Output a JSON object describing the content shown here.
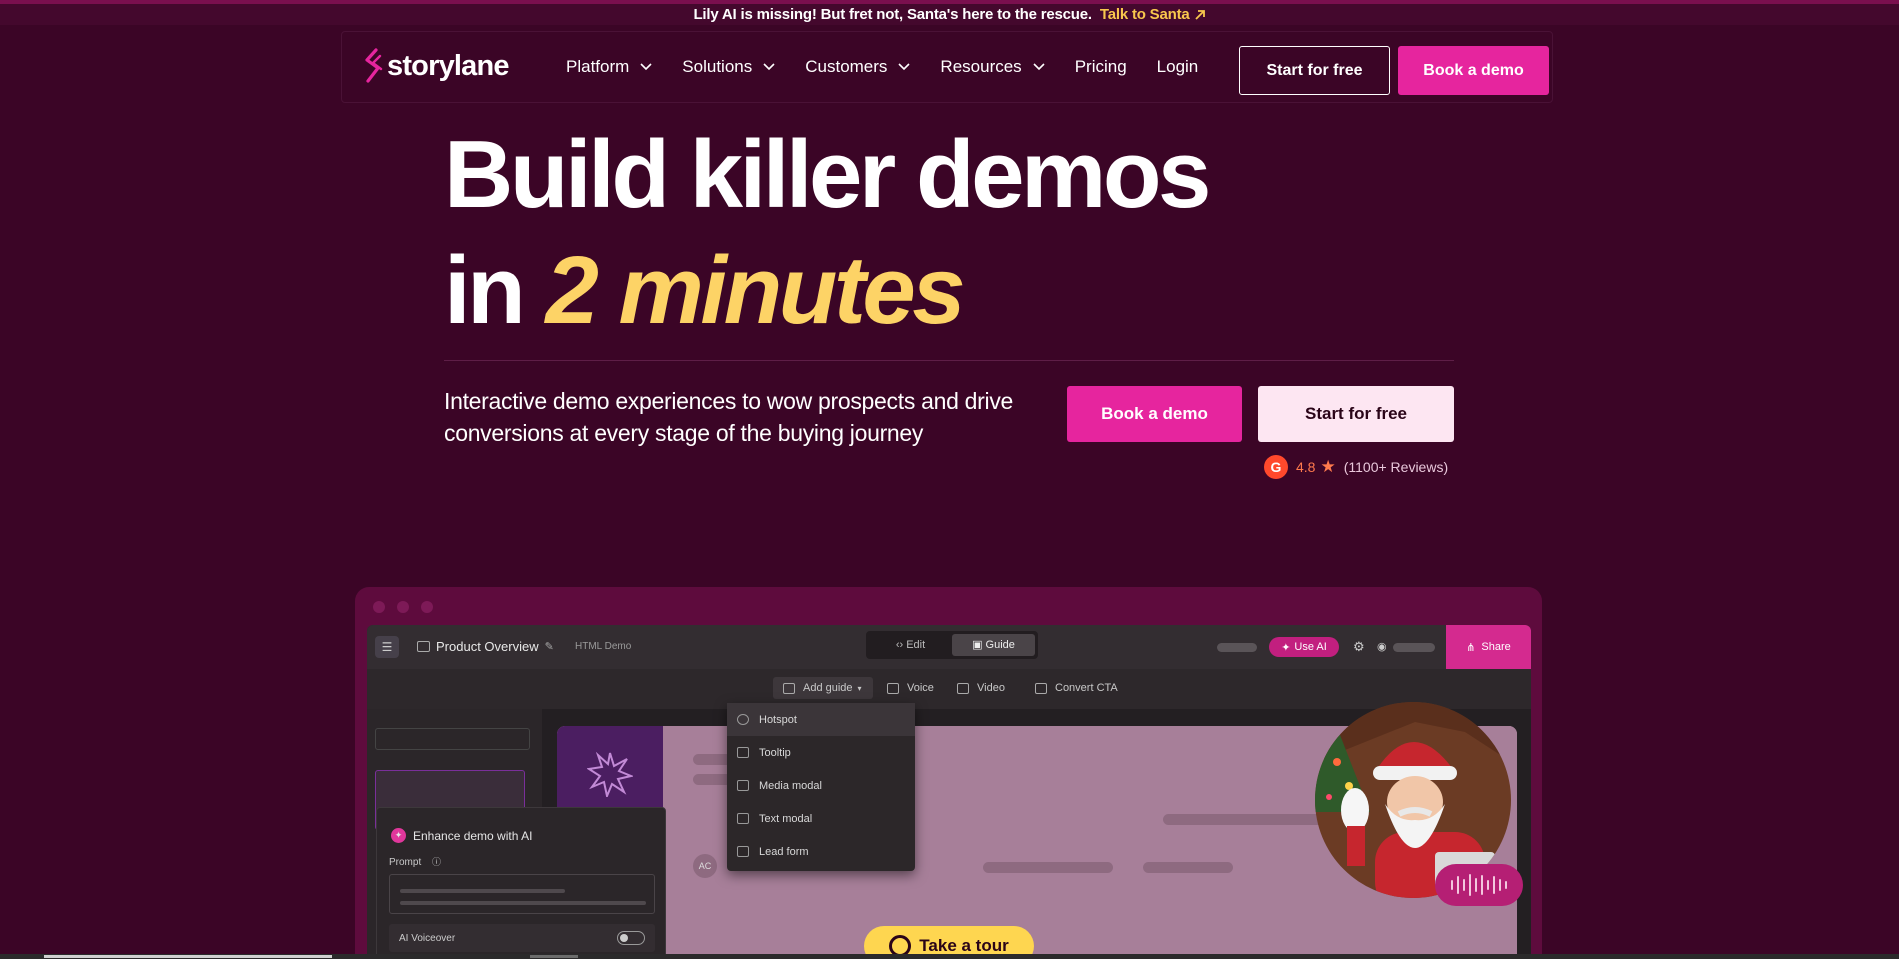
{
  "announcement": {
    "message": "Lily AI is missing! But fret not, Santa's here to the rescue.",
    "cta": "Talk to Santa",
    "cta_icon": "arrow-up-right-icon"
  },
  "nav": {
    "logo_text": "storylane",
    "items": [
      {
        "label": "Platform",
        "has_dropdown": true
      },
      {
        "label": "Solutions",
        "has_dropdown": true
      },
      {
        "label": "Customers",
        "has_dropdown": true
      },
      {
        "label": "Resources",
        "has_dropdown": true
      },
      {
        "label": "Pricing",
        "has_dropdown": false
      },
      {
        "label": "Login",
        "has_dropdown": false
      }
    ],
    "start_button": "Start for free",
    "demo_button": "Book a demo"
  },
  "hero": {
    "title_line1": "Build killer demos",
    "title_line2_prefix": "in",
    "title_line2_accent": "2 minutes",
    "subtitle": "Interactive demo experiences to wow prospects and drive conversions at every stage of the buying journey",
    "primary_button": "Book a demo",
    "secondary_button": "Start for free",
    "rating": {
      "badge": "G",
      "score": "4.8",
      "reviews": "(1100+ Reviews)"
    }
  },
  "preview": {
    "doc_title": "Product Overview",
    "doc_subtitle": "HTML Demo",
    "mode_tabs": [
      "Edit",
      "Guide"
    ],
    "active_mode": "Guide",
    "use_ai": "Use AI",
    "share": "Share",
    "toolbar": [
      "Add guide",
      "Voice",
      "Video",
      "Convert CTA"
    ],
    "guide_menu": [
      "Hotspot",
      "Tooltip",
      "Media modal",
      "Text modal",
      "Lead form"
    ],
    "enhance_title": "Enhance demo with AI",
    "prompt_label": "Prompt",
    "voiceover_label": "AI Voiceover",
    "avatar_initials": "AC",
    "tour_button": "Take a tour"
  },
  "colors": {
    "background": "#3b0526",
    "brand_pink": "#e6259e",
    "accent_yellow": "#fdd366",
    "tour_yellow": "#fed650"
  }
}
